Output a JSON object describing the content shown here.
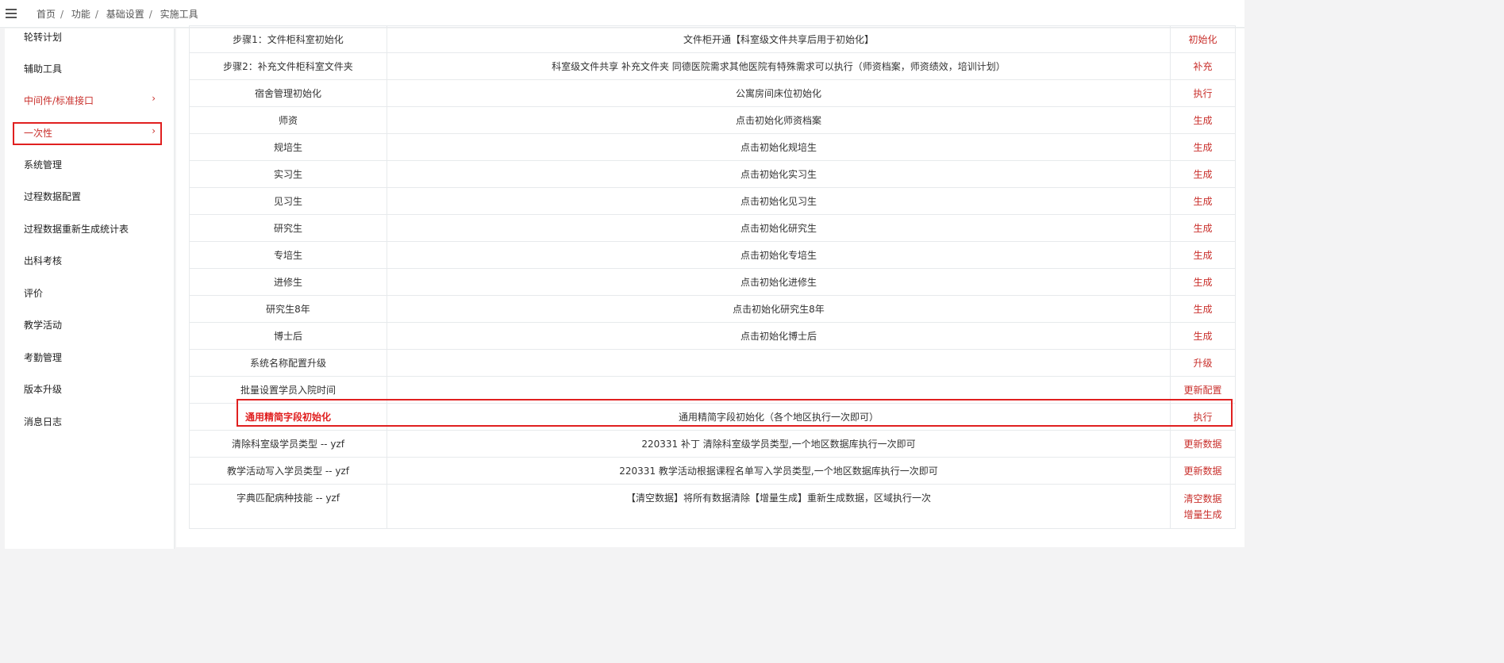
{
  "header": {
    "breadcrumb": [
      "首页",
      "功能",
      "基础设置",
      "实施工具"
    ]
  },
  "sidebar": {
    "items": [
      {
        "label": "轮转计划"
      },
      {
        "label": "辅助工具"
      },
      {
        "label": "中间件/标准接口"
      },
      {
        "label": "一次性"
      },
      {
        "label": "系统管理"
      },
      {
        "label": "过程数据配置"
      },
      {
        "label": "过程数据重新生成统计表"
      },
      {
        "label": "出科考核"
      },
      {
        "label": "评价"
      },
      {
        "label": "教学活动"
      },
      {
        "label": "考勤管理"
      },
      {
        "label": "版本升级"
      },
      {
        "label": "消息日志"
      }
    ],
    "chevron": "›"
  },
  "colors": {
    "accent": "#c9302c",
    "highlight": "#e02020",
    "border": "#e7eaec"
  },
  "table": {
    "rows": [
      {
        "name": "步骤1：文件柜科室初始化",
        "desc": "文件柜开通【科室级文件共享后用于初始化】",
        "actions": [
          "初始化"
        ]
      },
      {
        "name": "步骤2：补充文件柜科室文件夹",
        "desc": "科室级文件共享 补充文件夹 同德医院需求其他医院有特殊需求可以执行（师资档案，师资绩效，培训计划）",
        "actions": [
          "补充"
        ]
      },
      {
        "name": "宿舍管理初始化",
        "desc": "公寓房间床位初始化",
        "actions": [
          "执行"
        ]
      },
      {
        "name": "师资",
        "desc": "点击初始化师资档案",
        "actions": [
          "生成"
        ]
      },
      {
        "name": "规培生",
        "desc": "点击初始化规培生",
        "actions": [
          "生成"
        ]
      },
      {
        "name": "实习生",
        "desc": "点击初始化实习生",
        "actions": [
          "生成"
        ]
      },
      {
        "name": "见习生",
        "desc": "点击初始化见习生",
        "actions": [
          "生成"
        ]
      },
      {
        "name": "研究生",
        "desc": "点击初始化研究生",
        "actions": [
          "生成"
        ]
      },
      {
        "name": "专培生",
        "desc": "点击初始化专培生",
        "actions": [
          "生成"
        ]
      },
      {
        "name": "进修生",
        "desc": "点击初始化进修生",
        "actions": [
          "生成"
        ]
      },
      {
        "name": "研究生8年",
        "desc": "点击初始化研究生8年",
        "actions": [
          "生成"
        ]
      },
      {
        "name": "博士后",
        "desc": "点击初始化博士后",
        "actions": [
          "生成"
        ]
      },
      {
        "name": "系统名称配置升级",
        "desc": "",
        "actions": [
          "升级"
        ]
      },
      {
        "name": "批量设置学员入院时间",
        "desc": "",
        "actions": [
          "更新配置"
        ]
      },
      {
        "name": "通用精简字段初始化",
        "desc": "通用精简字段初始化（各个地区执行一次即可）",
        "actions": [
          "执行"
        ]
      },
      {
        "name": "清除科室级学员类型 -- yzf",
        "desc": "220331 补丁 清除科室级学员类型,一个地区数据库执行一次即可",
        "actions": [
          "更新数据"
        ]
      },
      {
        "name": "教学活动写入学员类型 -- yzf",
        "desc": "220331 教学活动根据课程名单写入学员类型,一个地区数据库执行一次即可",
        "actions": [
          "更新数据"
        ]
      },
      {
        "name": "字典匹配病种技能 -- yzf",
        "desc": "【清空数据】将所有数据清除【增量生成】重新生成数据，区域执行一次",
        "actions": [
          "清空数据",
          "增量生成"
        ]
      }
    ]
  }
}
